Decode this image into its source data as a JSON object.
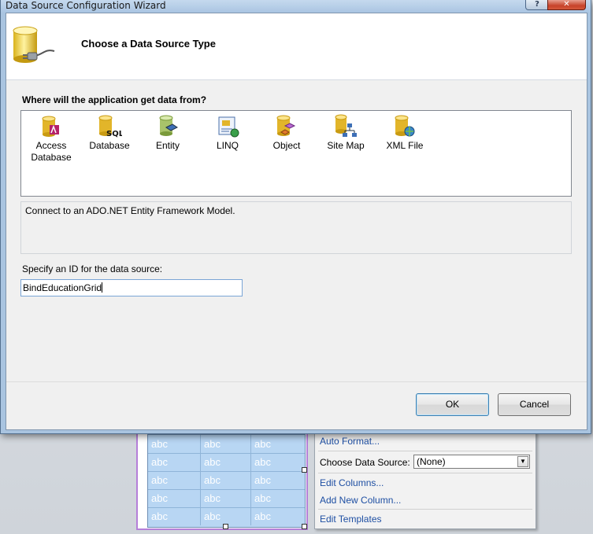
{
  "window": {
    "title": "Data Source Configuration Wizard",
    "help_glyph": "?",
    "close_glyph": "✕"
  },
  "header": {
    "title": "Choose a Data Source Type"
  },
  "source_types": {
    "prompt": "Where will the application get data from?",
    "items": [
      {
        "label": "Access Database",
        "icon": "access-database-icon"
      },
      {
        "label": "Database",
        "icon": "sql-database-icon"
      },
      {
        "label": "Entity",
        "icon": "entity-icon"
      },
      {
        "label": "LINQ",
        "icon": "linq-icon"
      },
      {
        "label": "Object",
        "icon": "object-icon"
      },
      {
        "label": "Site Map",
        "icon": "site-map-icon"
      },
      {
        "label": "XML File",
        "icon": "xml-file-icon"
      }
    ],
    "description": "Connect to an ADO.NET Entity Framework Model."
  },
  "data_source_id": {
    "label": "Specify an ID for the data source:",
    "value": "BindEducationGrid"
  },
  "buttons": {
    "ok": "OK",
    "cancel": "Cancel"
  },
  "background": {
    "grid_cell": "abc",
    "tasks": {
      "auto_format": "Auto Format...",
      "choose_data_source_label": "Choose Data Source:",
      "choose_data_source_value": "(None)",
      "edit_columns": "Edit Columns...",
      "add_new_column": "Add New Column...",
      "edit_templates": "Edit Templates"
    }
  },
  "colors": {
    "title_bar": "#aac5e2",
    "close_button": "#c7432a",
    "link": "#1e4fa3",
    "grid_background": "#b8d6f3",
    "grid_selection": "#b57fd9"
  }
}
